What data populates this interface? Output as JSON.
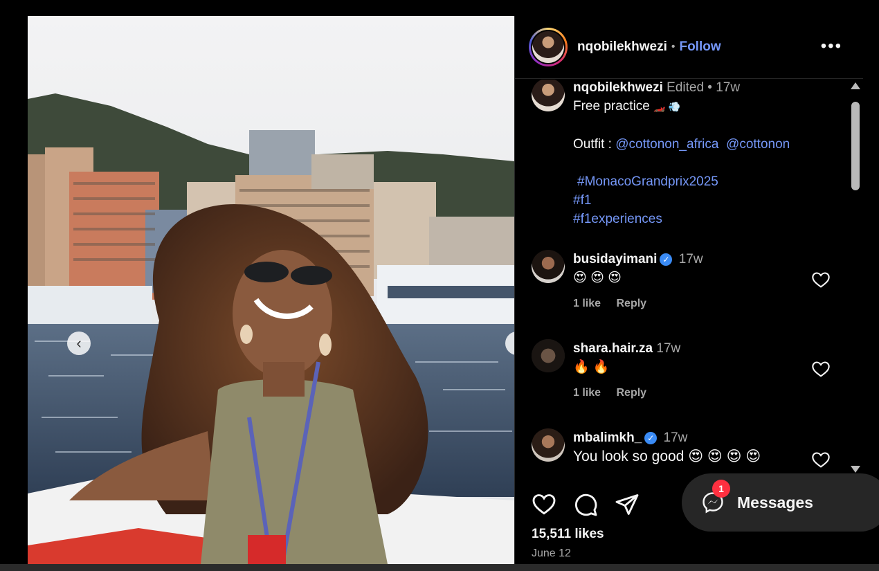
{
  "post": {
    "username": "nqobilekhwezi",
    "follow_label": "Follow",
    "likes": "15,511 likes",
    "date": "June 12"
  },
  "caption": {
    "username": "nqobilekhwezi",
    "edited": "Edited",
    "time": "17w",
    "line1": "Free practice",
    "line1_emoji": "🏎️ 💨",
    "outfit_label": "Outfit :",
    "mention1": "@cottonon_africa",
    "mention2": "@cottonon",
    "tags": [
      "#MonacoGrandprix2025",
      "#f1",
      "#f1experiences"
    ]
  },
  "comments": [
    {
      "username": "busidayimani",
      "verified": true,
      "time": "17w",
      "text": "😍 😍 😍",
      "likes": "1 like",
      "reply": "Reply"
    },
    {
      "username": "shara.hair.za",
      "verified": false,
      "time": "17w",
      "text": "🔥 🔥",
      "likes": "1 like",
      "reply": "Reply"
    },
    {
      "username": "mbalimkh_",
      "verified": true,
      "time": "17w",
      "text": "You look so good 😍 😍 😍 😍"
    }
  ],
  "messages": {
    "label": "Messages",
    "badge": "1"
  },
  "icons": {
    "more": "more-options-icon",
    "like": "heart-icon",
    "comment": "comment-icon",
    "share": "send-icon",
    "messenger": "messenger-icon",
    "verified": "verified-badge-icon"
  },
  "colors": {
    "link": "#7597f7",
    "badge": "#ff3040",
    "verified": "#3a8bf5"
  }
}
